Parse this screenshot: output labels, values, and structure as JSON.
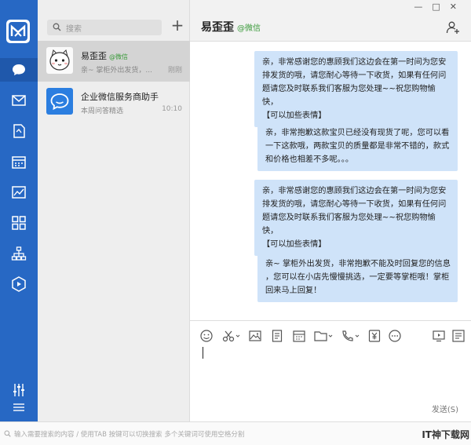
{
  "colors": {
    "rail": "#2768c4",
    "bubble": "#cfe3f9",
    "selected": "#d4d4d4",
    "wechat_green": "#3a9a3a"
  },
  "search": {
    "placeholder": "搜索"
  },
  "conversations": [
    {
      "name": "易歪歪",
      "tag": "@微信",
      "preview": "亲~ 掌柜外出发货，...",
      "time": "刚刚",
      "avatar": "cat-avatar-icon"
    },
    {
      "name": "企业微信服务商助手",
      "tag": "",
      "preview": "本周问答精选",
      "time": "10:10",
      "avatar": "chat-bubble-icon"
    }
  ],
  "chat": {
    "title": "易歪歪",
    "subtitle": "@微信",
    "messages": [
      {
        "lines": [
          "亲，非常感谢您的惠顾我们这边会在第一时间为您安",
          "排发货的哦，请您耐心等待一下收货，如果有任何问",
          "题请您及时联系我们客服为您处理~~祝您购物愉快，",
          "【可以加些表情】"
        ]
      },
      {
        "lines": [
          "亲，非常抱歉这款宝贝已经没有现货了呢，您可以看",
          "一下这款哦，两款宝贝的质量都是非常不错的，款式",
          "和价格也相差不多呢。。。"
        ]
      },
      {
        "lines": [
          "亲，非常感谢您的惠顾我们这边会在第一时间为您安",
          "排发货的哦，请您耐心等待一下收货，如果有任何问",
          "题请您及时联系我们客服为您处理~~祝您购物愉快，",
          "【可以加些表情】"
        ]
      },
      {
        "lines": [
          "亲~ 掌柜外出发货，非常抱歉不能及时回复您的信息",
          "，您可以在小店先慢慢挑选，一定要等掌柜哦！掌柜",
          "回来马上回复！"
        ]
      }
    ]
  },
  "toolbar": {
    "send_label": "发送(S)"
  },
  "bottom": {
    "placeholder": "输入需要搜索的内容 / 使用TAB 按键可以切换搜索 多个关键词可使用空格分割"
  },
  "watermark": "IT神下载网"
}
